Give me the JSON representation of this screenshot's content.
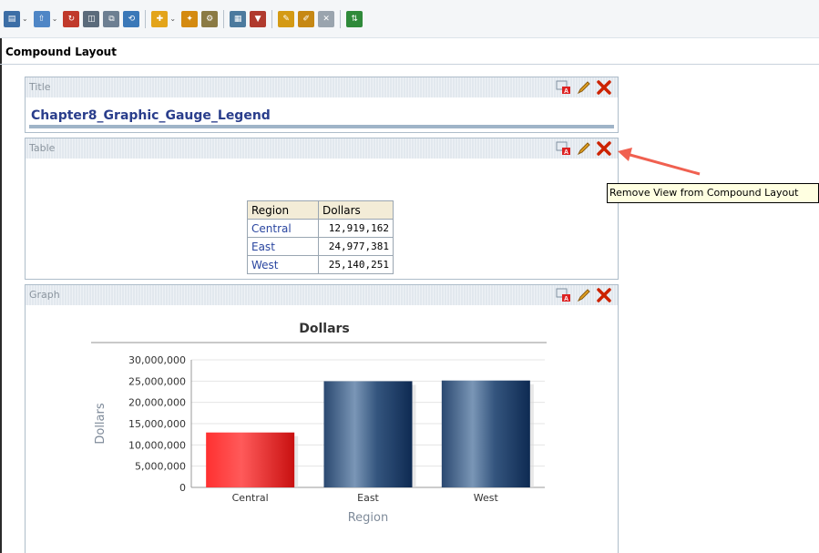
{
  "toolbar": {
    "icons": [
      "print-icon",
      "export-icon",
      "refresh-icon",
      "preview-icon",
      "copy-icon",
      "reload-icon",
      "new-view-icon",
      "properties-icon",
      "settings-icon",
      "table-icon",
      "filter-icon",
      "edit-icon",
      "edit-alt-icon",
      "remove-icon",
      "sort-icon"
    ]
  },
  "layout": {
    "title": "Compound Layout"
  },
  "title_view": {
    "label": "Title",
    "value": "Chapter8_Graphic_Gauge_Legend"
  },
  "table_view": {
    "label": "Table",
    "headers": [
      "Region",
      "Dollars"
    ],
    "rows": [
      {
        "region": "Central",
        "dollars": "12,919,162"
      },
      {
        "region": "East",
        "dollars": "24,977,381"
      },
      {
        "region": "West",
        "dollars": "25,140,251"
      }
    ]
  },
  "graph_view": {
    "label": "Graph"
  },
  "tooltip": {
    "text": "Remove View from Compound Layout"
  },
  "colors": {
    "central_bar": "#e82020",
    "region_bar": "#2e4e76",
    "remove": "#cc2200",
    "arrow": "#f06050"
  },
  "chart_data": {
    "type": "bar",
    "title": "Dollars",
    "xlabel": "Region",
    "ylabel": "Dollars",
    "categories": [
      "Central",
      "East",
      "West"
    ],
    "values": [
      12919162,
      24977381,
      25140251
    ],
    "ylim": [
      0,
      30000000
    ],
    "yticks": [
      "0",
      "5,000,000",
      "10,000,000",
      "15,000,000",
      "20,000,000",
      "25,000,000",
      "30,000,000"
    ],
    "grid": true
  }
}
